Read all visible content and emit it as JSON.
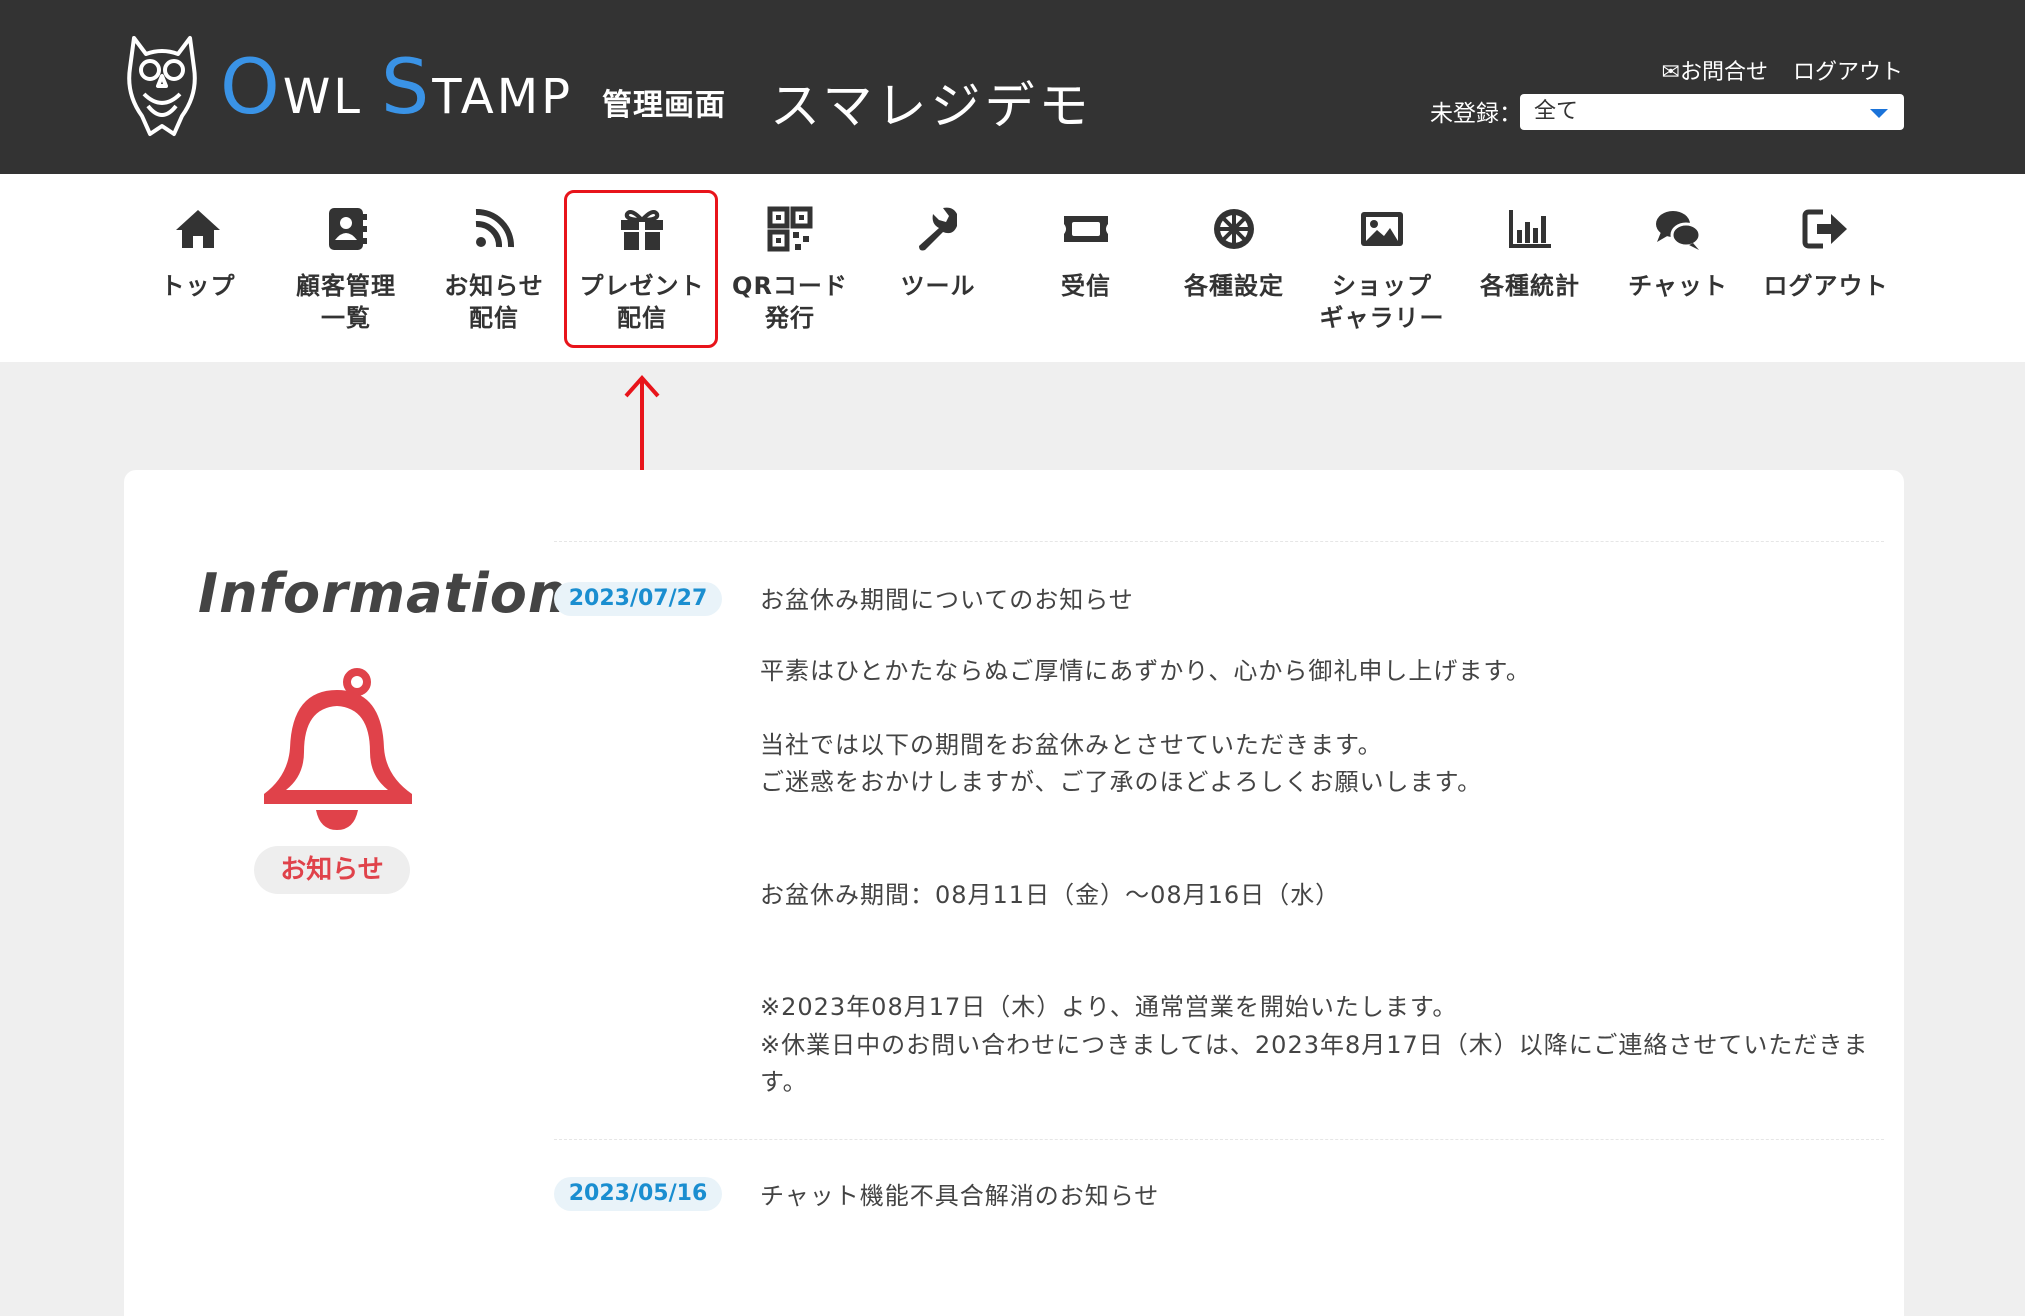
{
  "header": {
    "brand_o": "O",
    "brand_wl": "WL",
    "brand_s": "S",
    "brand_tamp": "TAMP",
    "brand_sub": "管理画面",
    "shop_name": "スマレジデモ",
    "contact_link": "✉お問合せ",
    "logout_link": "ログアウト",
    "filter_label": "未登録：",
    "filter_value": "全て"
  },
  "nav": {
    "items": [
      {
        "label": "トップ",
        "icon": "home-icon"
      },
      {
        "label": "顧客管理\n一覧",
        "icon": "address-book-icon"
      },
      {
        "label": "お知らせ\n配信",
        "icon": "rss-icon"
      },
      {
        "label": "プレゼント\n配信",
        "icon": "gift-icon"
      },
      {
        "label": "QRコード\n発行",
        "icon": "qrcode-icon"
      },
      {
        "label": "ツール",
        "icon": "wrench-icon"
      },
      {
        "label": "受信",
        "icon": "ticket-icon"
      },
      {
        "label": "各種設定",
        "icon": "gear-icon"
      },
      {
        "label": "ショップ\nギャラリー",
        "icon": "image-icon"
      },
      {
        "label": "各種統計",
        "icon": "bar-chart-icon"
      },
      {
        "label": "チャット",
        "icon": "chat-icon"
      },
      {
        "label": "ログアウト",
        "icon": "sign-out-icon"
      }
    ]
  },
  "colors": {
    "header_bg": "#333333",
    "brand_blue": "#3a93e6",
    "highlight_red": "#e8141b",
    "bell_red": "#e0424a",
    "date_blue": "#1a8ed0"
  },
  "info": {
    "title": "Information",
    "badge": "お知らせ",
    "news": [
      {
        "date": "2023/07/27",
        "title": "お盆休み期間についてのお知らせ",
        "body": [
          "平素はひとかたならぬご厚情にあずかり、心から御礼申し上げます。",
          "当社では以下の期間をお盆休みとさせていただきます。",
          "ご迷惑をおかけしますが、ご了承のほどよろしくお願いします。",
          "お盆休み期間：08月11日（金）〜08月16日（水）",
          "※2023年08月17日（木）より、通常営業を開始いたします。",
          "※休業日中のお問い合わせにつきましては、2023年8月17日（木）以降にご連絡させていただきま",
          "す。"
        ]
      },
      {
        "date": "2023/05/16",
        "title": "チャット機能不具合解消のお知らせ"
      }
    ]
  }
}
